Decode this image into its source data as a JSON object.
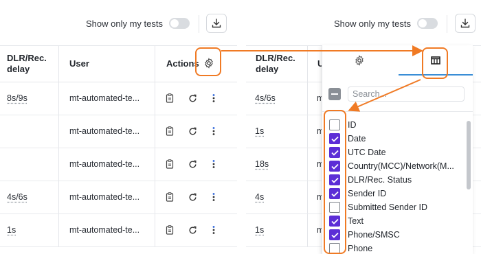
{
  "toolbar": {
    "show_only_label": "Show only my tests",
    "toggle_on": false
  },
  "table": {
    "headers": {
      "dlr": "DLR/Rec. delay",
      "user": "User",
      "actions": "Actions"
    },
    "left_rows": [
      {
        "dlr": "8s/9s",
        "user": "mt-automated-te..."
      },
      {
        "dlr": "",
        "user": "mt-automated-te..."
      },
      {
        "dlr": "",
        "user": "mt-automated-te..."
      },
      {
        "dlr": "4s/6s",
        "user": "mt-automated-te..."
      },
      {
        "dlr": "1s",
        "user": "mt-automated-te..."
      }
    ],
    "right_rows": [
      {
        "dlr": "4s/6s",
        "user": "m"
      },
      {
        "dlr": "1s",
        "user": "m"
      },
      {
        "dlr": "18s",
        "user": "m"
      },
      {
        "dlr": "4s",
        "user": "m"
      },
      {
        "dlr": "1s",
        "user": "m"
      }
    ],
    "right_user_header": "U"
  },
  "popup": {
    "search_placeholder": "Search...",
    "columns": [
      {
        "label": "ID",
        "checked": false
      },
      {
        "label": "Date",
        "checked": true
      },
      {
        "label": "UTC Date",
        "checked": true
      },
      {
        "label": "Country(MCC)/Network(M...",
        "checked": true
      },
      {
        "label": "DLR/Rec. Status",
        "checked": true
      },
      {
        "label": "Sender ID",
        "checked": true
      },
      {
        "label": "Submitted Sender ID",
        "checked": false
      },
      {
        "label": "Text",
        "checked": true
      },
      {
        "label": "Phone/SMSC",
        "checked": true
      },
      {
        "label": "Phone",
        "checked": false
      }
    ]
  },
  "colors": {
    "accent": "#5c2ed6",
    "highlight": "#f07a24",
    "tab_underline": "#3a8ed6"
  },
  "icons": [
    "toggle",
    "download-icon",
    "gear-icon",
    "columns-icon",
    "clipboard-icon",
    "refresh-icon",
    "more-vertical-icon",
    "checkmark-icon",
    "minus-icon"
  ]
}
